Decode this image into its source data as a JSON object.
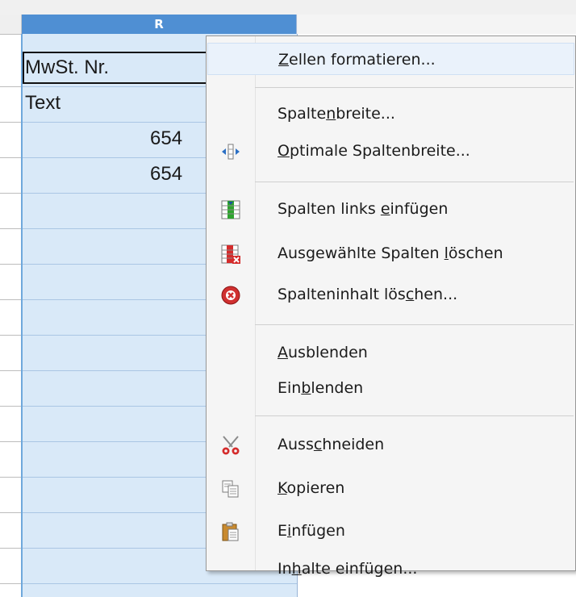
{
  "sheet": {
    "selected_column": "R",
    "cells": {
      "r1": "MwSt. Nr.",
      "r2": "Text",
      "r3": "654",
      "r4": "654"
    }
  },
  "context_menu": {
    "items": [
      {
        "name": "format-cells",
        "label_pre": "",
        "label_key": "Z",
        "label_post": "ellen formatieren...",
        "icon": "",
        "highlighted": true
      },
      {
        "name": "column-width",
        "label_pre": "Spalte",
        "label_key": "n",
        "label_post": "breite...",
        "icon": ""
      },
      {
        "name": "optimal-column-width",
        "label_pre": "",
        "label_key": "O",
        "label_post": "ptimale Spaltenbreite...",
        "icon": "resize-horizontal-icon"
      },
      {
        "name": "insert-columns-left",
        "label_pre": "Spalten links ",
        "label_key": "e",
        "label_post": "infügen",
        "icon": "insert-column-icon"
      },
      {
        "name": "delete-columns",
        "label_pre": "Ausgewählte Spalten ",
        "label_key": "l",
        "label_post": "öschen",
        "icon": "delete-column-icon"
      },
      {
        "name": "clear-column-contents",
        "label_pre": "Spalteninhalt lös",
        "label_key": "c",
        "label_post": "hen...",
        "icon": "clear-contents-icon"
      },
      {
        "name": "hide",
        "label_pre": "",
        "label_key": "A",
        "label_post": "usblenden",
        "icon": ""
      },
      {
        "name": "show",
        "label_pre": "Ein",
        "label_key": "b",
        "label_post": "lenden",
        "icon": ""
      },
      {
        "name": "cut",
        "label_pre": "Auss",
        "label_key": "c",
        "label_post": "hneiden",
        "icon": "scissors-icon"
      },
      {
        "name": "copy",
        "label_pre": "",
        "label_key": "K",
        "label_post": "opieren",
        "icon": "copy-icon"
      },
      {
        "name": "paste",
        "label_pre": "E",
        "label_key": "i",
        "label_post": "nfügen",
        "icon": "paste-icon"
      },
      {
        "name": "paste-special",
        "label_pre": "In",
        "label_key": "h",
        "label_post": "alte einfügen...",
        "icon": ""
      }
    ]
  },
  "colors": {
    "selection": "#d9e9f8",
    "header_selected": "#4f8fd3",
    "menu_bg": "#f5f5f5"
  }
}
